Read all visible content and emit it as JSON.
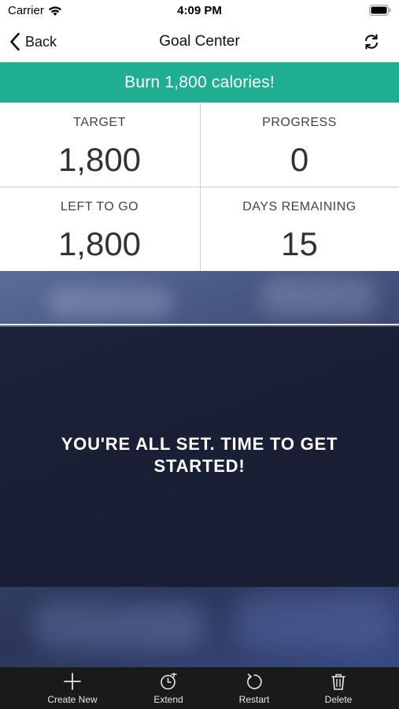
{
  "status_bar": {
    "carrier": "Carrier",
    "time": "4:09 PM"
  },
  "nav": {
    "back_label": "Back",
    "title": "Goal Center"
  },
  "goal": {
    "banner": "Burn 1,800 calories!"
  },
  "stats": [
    {
      "label": "TARGET",
      "value": "1,800"
    },
    {
      "label": "PROGRESS",
      "value": "0"
    },
    {
      "label": "LEFT TO GO",
      "value": "1,800"
    },
    {
      "label": "DAYS REMAINING",
      "value": "15"
    }
  ],
  "hero": {
    "message": "YOU'RE ALL SET. TIME TO GET STARTED!"
  },
  "tab_bar": {
    "items": [
      {
        "label": "Create New",
        "icon": "plus-icon"
      },
      {
        "label": "Extend",
        "icon": "clock-icon"
      },
      {
        "label": "Restart",
        "icon": "restart-icon"
      },
      {
        "label": "Delete",
        "icon": "trash-icon"
      }
    ]
  },
  "colors": {
    "accent": "#20ae93",
    "tab_bar_bg": "#1a1a1a"
  }
}
